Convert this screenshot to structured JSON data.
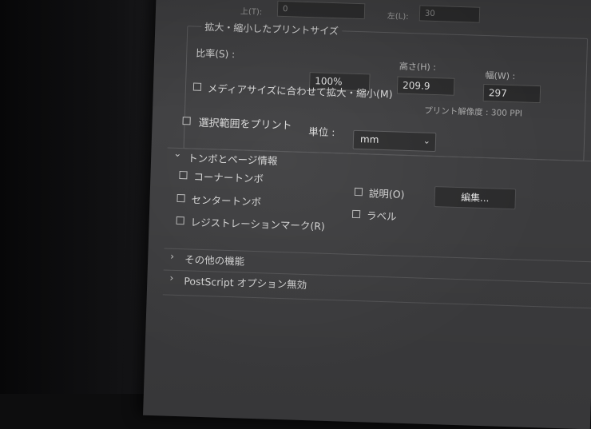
{
  "top_fields": {
    "top_label": "上(T):",
    "top_value": "0",
    "left_label": "左(L):",
    "left_value": "30"
  },
  "scaled_print": {
    "group_title": "拡大・縮小したプリントサイズ",
    "scale_label": "比率(S) :",
    "scale_value": "100%",
    "height_label": "高さ(H) :",
    "height_value": "209.9",
    "width_label": "幅(W) :",
    "width_value": "297",
    "fit_media_label": "メディアサイズに合わせて拡大・縮小(M)",
    "resolution_label": "プリント解像度 : 300 PPI"
  },
  "print_selection": {
    "label": "選択範囲をプリント",
    "unit_label": "単位 :",
    "unit_value": "mm"
  },
  "marks_section": {
    "title": "トンボとページ情報",
    "corner_crop_marks": "コーナートンボ",
    "center_crop_marks": "センタートンボ",
    "registration_marks": "レジストレーションマーク(R)",
    "description": "説明(O)",
    "labels": "ラベル",
    "edit_button": "編集..."
  },
  "other_functions": {
    "title": "その他の機能"
  },
  "postscript": {
    "title": "PostScript オプション無効"
  }
}
